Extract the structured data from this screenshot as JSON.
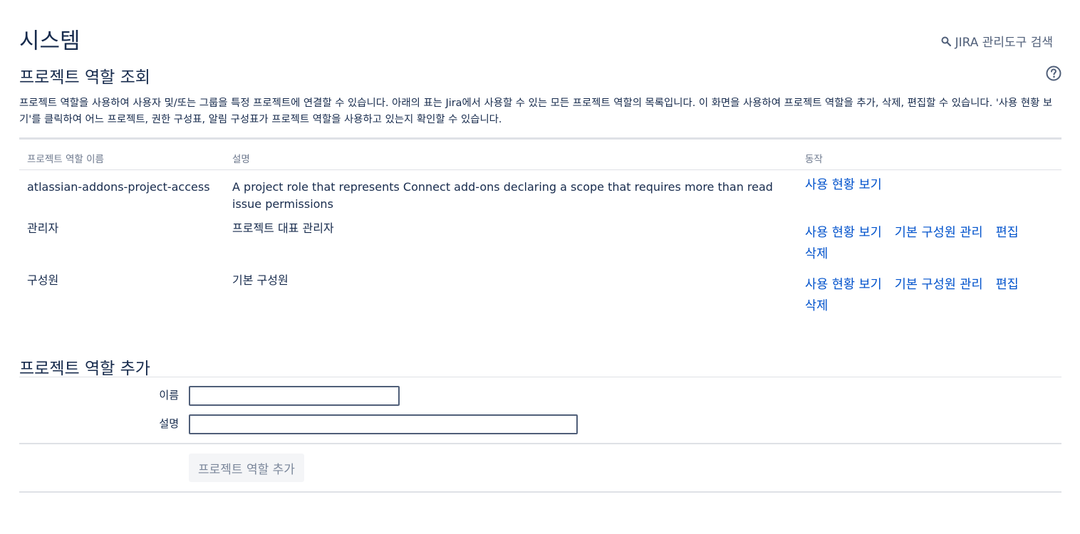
{
  "page": {
    "title": "시스템",
    "admin_search_label": "JIRA 관리도구 검색"
  },
  "view_section": {
    "title": "프로젝트 역할 조회",
    "description": "프로젝트 역할을 사용하여 사용자 및/또는 그룹을 특정 프로젝트에 연결할 수 있습니다. 아래의 표는 Jira에서 사용할 수 있는 모든 프로젝트 역할의 목록입니다. 이 화면을 사용하여 프로젝트 역할을 추가, 삭제, 편집할 수 있습니다. '사용 현황 보기'를 클릭하여 어느 프로젝트, 권한 구성표, 알림 구성표가 프로젝트 역할을 사용하고 있는지 확인할 수 있습니다."
  },
  "table": {
    "headers": [
      "프로젝트 역할 이름",
      "설명",
      "동작"
    ],
    "rows": [
      {
        "name": "atlassian-addons-project-access",
        "description": "A project role that represents Connect add-ons declaring a scope that requires more than read issue permissions",
        "actions": [
          "사용 현황 보기"
        ]
      },
      {
        "name": "관리자",
        "description": "프로젝트 대표 관리자",
        "actions": [
          "사용 현황 보기",
          "기본 구성원 관리",
          "편집",
          "삭제"
        ]
      },
      {
        "name": "구성원",
        "description": "기본 구성원",
        "actions": [
          "사용 현황 보기",
          "기본 구성원 관리",
          "편집",
          "삭제"
        ]
      }
    ]
  },
  "add_section": {
    "title": "프로젝트 역할 추가",
    "name_label": "이름",
    "name_value": "",
    "description_label": "설명",
    "description_value": "",
    "submit_label": "프로젝트 역할 추가"
  },
  "colors": {
    "link": "#0052cc",
    "text": "#172b4d",
    "muted": "#6b778c",
    "border": "#dfe1e6"
  }
}
